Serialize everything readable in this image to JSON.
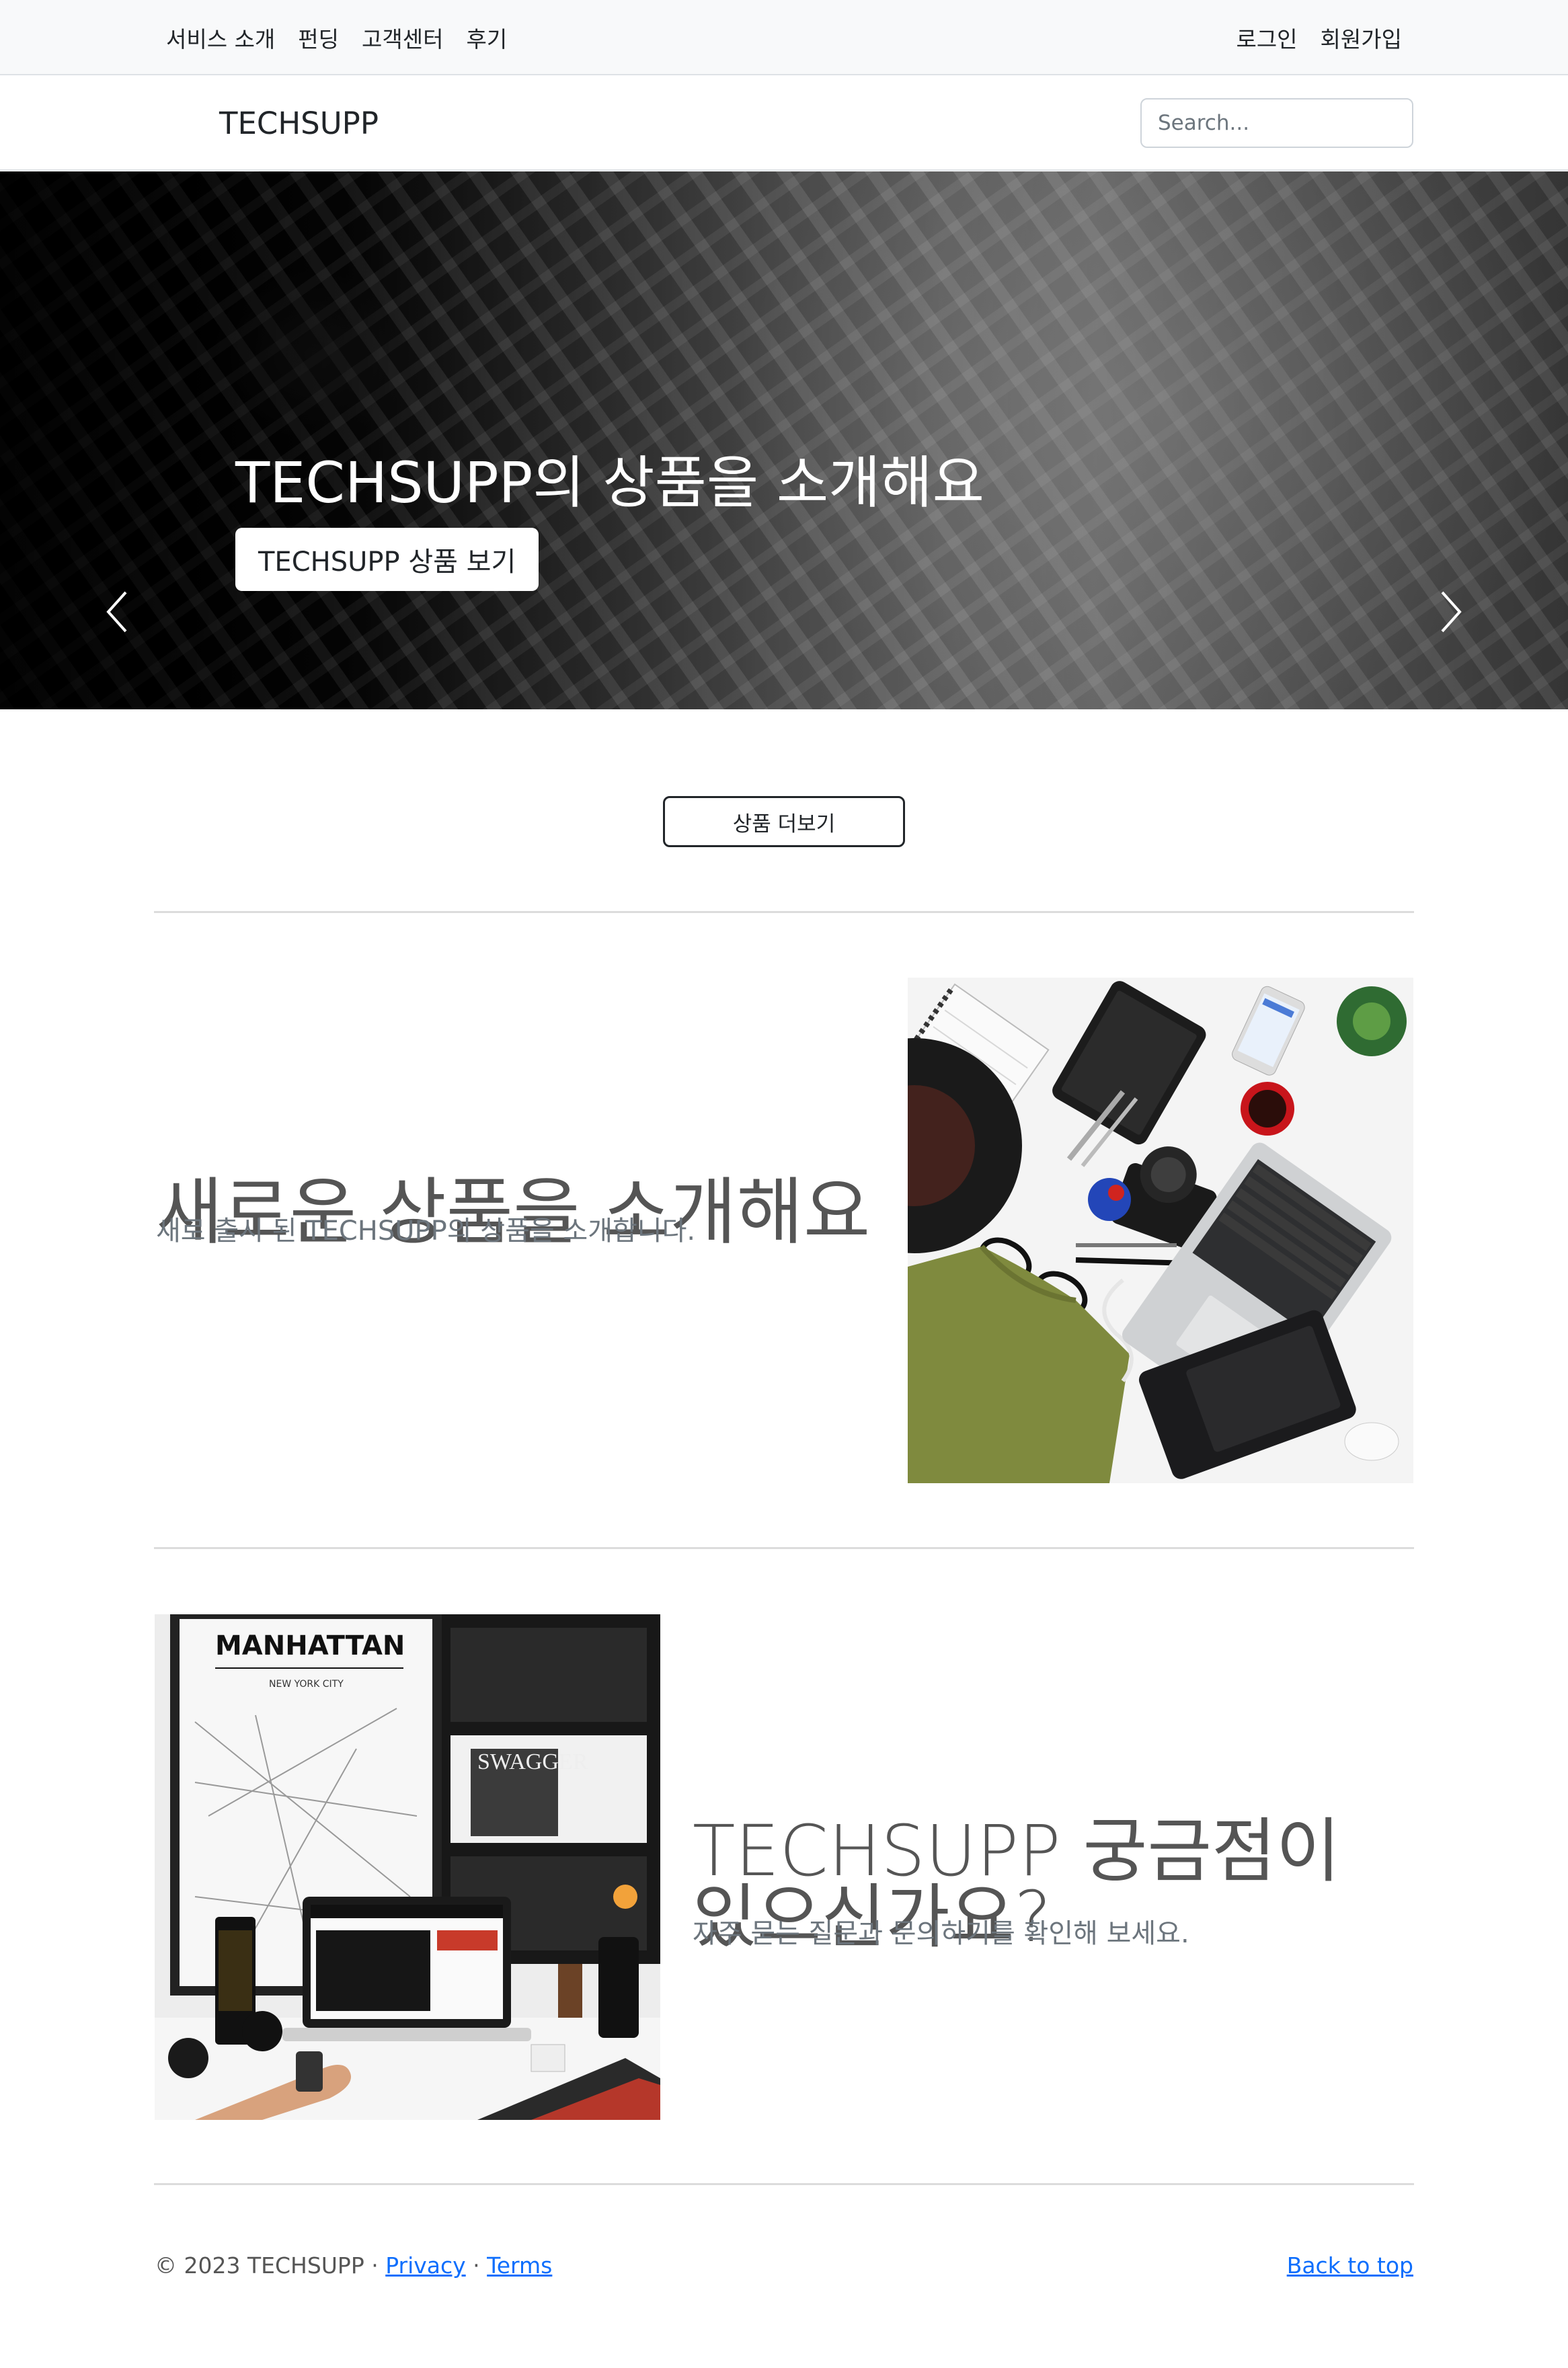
{
  "topbar": {
    "left_links": [
      "서비스 소개",
      "펀딩",
      "고객센터",
      "후기"
    ],
    "right_links": [
      "로그인",
      "회원가입"
    ]
  },
  "header": {
    "brand": "TECHSUPP",
    "search_placeholder": "Search..."
  },
  "carousel": {
    "title": "TECHSUPP의 상품을 소개해요",
    "button_label": "TECHSUPP 상품 보기",
    "slide_count": 3,
    "active_index": 0
  },
  "more_button_label": "상품 더보기",
  "feature1": {
    "heading": "새로운 상품을 소개해요",
    "subtext": "새로 출시 된 TECHSUPP의 상품을 소개합니다."
  },
  "feature2": {
    "heading": "TECHSUPP 궁금점이 있으신가요?",
    "subtext": "자주 묻는 질문과 문의하기를 확인해 보세요.",
    "image_text_title": "MANHATTAN",
    "image_text_subtitle": "NEW YORK CITY",
    "image_text_brand": "SWAGGER"
  },
  "footer": {
    "copyright": "© 2023 TECHSUPP · ",
    "privacy": "Privacy",
    "separator": " · ",
    "terms": "Terms",
    "back_to_top": "Back to top"
  },
  "colors": {
    "link": "#0d6efd",
    "heading": "#555555",
    "muted": "#6c757d"
  }
}
